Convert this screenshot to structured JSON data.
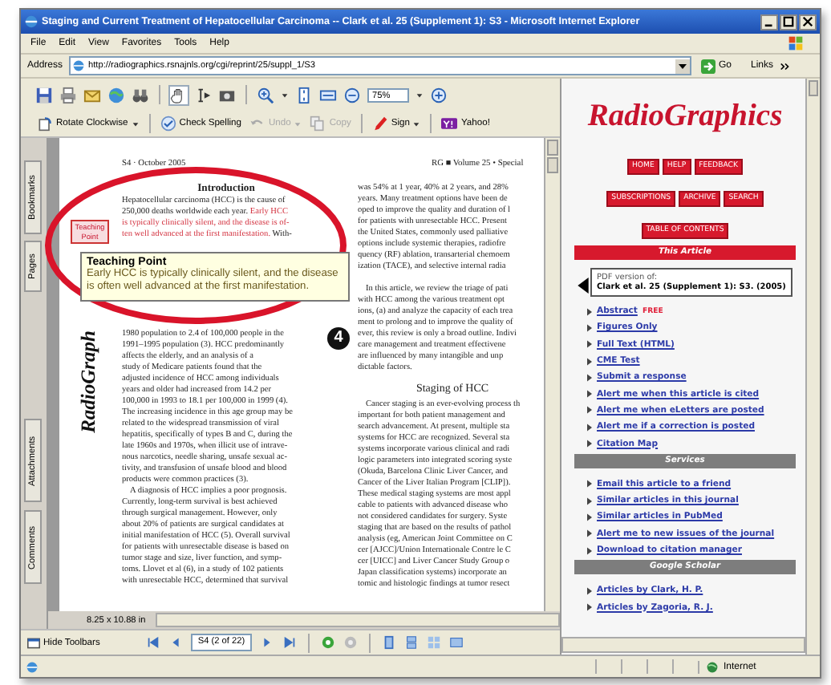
{
  "window": {
    "title": "Staging and Current Treatment of Hepatocellular Carcinoma -- Clark et al. 25 (Supplement 1): S3 - Microsoft Internet Explorer"
  },
  "menu": [
    "File",
    "Edit",
    "View",
    "Favorites",
    "Tools",
    "Help"
  ],
  "address_bar": {
    "label": "Address",
    "url": "http://radiographics.rsnajnls.org/cgi/reprint/25/suppl_1/S3",
    "go": "Go",
    "links": "Links"
  },
  "pdf_viewer": {
    "zoom": "75%",
    "buttons": [
      {
        "label": "Rotate Clockwise",
        "dropdown": true,
        "disabled": false
      },
      {
        "label": "Check Spelling",
        "dropdown": false,
        "disabled": false
      },
      {
        "label": "Undo",
        "dropdown": true,
        "disabled": true
      },
      {
        "label": "Copy",
        "dropdown": false,
        "disabled": true
      },
      {
        "label": "Sign",
        "dropdown": true,
        "disabled": false
      },
      {
        "label": "Yahoo!",
        "dropdown": false,
        "disabled": false
      }
    ],
    "side_tabs": [
      "Bookmarks",
      "Pages",
      "Attachments",
      "Comments"
    ],
    "page": {
      "header_left": "S4 · October 2005",
      "header_right": "RG ■ Volume 25 • Special",
      "spine": "RadioGraph",
      "left_column": {
        "heading": "Introduction",
        "lines_top": [
          {
            "segments": [
              {
                "text": "Hepatocellular carcinoma (HCC) is the cause of",
                "highlighted": false
              }
            ]
          },
          {
            "segments": [
              {
                "text": "250,000 deaths worldwide each year.",
                "highlighted": false
              },
              {
                "text": "Early HCC",
                "highlighted": true
              }
            ]
          },
          {
            "segments": [
              {
                "text": "is typically clinically silent, and the disease is of-",
                "highlighted": true
              }
            ]
          },
          {
            "segments": [
              {
                "text": "ten well advanced at the first manifestation.",
                "highlighted": true
              },
              {
                "text": "With-",
                "highlighted": false
              }
            ]
          }
        ],
        "paragraphs_bottom": [
          {
            "lines": [
              "1980 population to 2.4 of 100,000 people in the",
              "1991–1995 population (3). HCC predominantly",
              "affects the elderly, and an analysis of a",
              "study of Medicare patients found that the",
              "adjusted incidence of HCC among individuals",
              "years and older had increased from 14.2 per",
              "100,000 in 1993 to 18.1 per 100,000 in 1999 (4).",
              "The increasing incidence in this age group may be",
              "related to the widespread transmission of viral",
              "hepatitis, specifically of types B and C, during the",
              "late 1960s and 1970s, when illicit use of intrave-",
              "nous narcotics, needle sharing, unsafe sexual ac-",
              "tivity, and transfusion of unsafe blood and blood",
              "products were common practices (3)."
            ]
          },
          {
            "lines": [
              "A diagnosis of HCC implies a poor prognosis.",
              "Currently, long-term survival is best achieved",
              "through surgical management. However, only",
              "about 20% of patients are surgical candidates at",
              "initial manifestation of HCC (5). Overall survival",
              "for patients with unresectable disease is based on",
              "tumor stage and size, liver function, and symp-",
              "toms. Llovet et al (6), in a study of 102 patients",
              "with unresectable HCC, determined that survival"
            ]
          }
        ]
      },
      "right_column": {
        "blocks": [
          {
            "kind": "paragraph",
            "lines": [
              "was 54% at 1 year, 40% at 2 years, and 28%",
              "years. Many treatment options have been de",
              "oped to improve the quality and duration of l",
              "for patients with unresectable HCC. Present",
              "the United States, commonly used palliative",
              "options include systemic therapies, radiofre",
              "quency (RF) ablation, transarterial chemoem",
              "ization (TACE), and selective internal radia"
            ]
          },
          {
            "kind": "paragraph",
            "lines": [
              "In this article, we review the triage of pati",
              "with HCC among the various treatment opt",
              "ions, (a) and analyze the capacity of each trea",
              "ment to prolong and to improve the quality of",
              "ever, this review is only a broad outline. Indivi",
              "care management and treatment effectivene",
              "are influenced by many intangible and unp",
              "dictable factors."
            ]
          },
          {
            "kind": "heading",
            "text": "Staging of HCC"
          },
          {
            "kind": "paragraph",
            "lines": [
              "Cancer staging is an ever-evolving process th",
              "important for both patient management and",
              "search advancement. At present, multiple sta",
              "systems for HCC are recognized. Several sta",
              "systems incorporate various clinical and radi",
              "logic parameters into integrated scoring syste",
              "(Okuda, Barcelona Clinic Liver Cancer, and",
              "Cancer of the Liver Italian Program [CLIP]).",
              "These medical staging systems are most appl",
              "cable to patients with advanced disease who",
              "not considered candidates for surgery. Syste",
              "staging that are based on the results of pathol",
              "analysis (eg, American Joint Committee on C",
              "cer [AJCC]/Union Internationale Contre le C",
              "cer [UICC] and Liver Cancer Study Group o",
              "Japan classification systems) incorporate an",
              "tomic and histologic findings at tumor resect"
            ]
          }
        ]
      }
    },
    "teaching_point": {
      "button": "Teaching Point",
      "title": "Teaching Point",
      "text": "Early HCC is typically clinically silent, and the disease is often well advanced at the first manifestation."
    },
    "callout_number": "4",
    "page_size": "8.25 x 10.88 in",
    "hide_toolbars": "Hide Toolbars",
    "page_field": "S4 (2 of 22)"
  },
  "sidebar": {
    "logo": "RadioGraphics",
    "nav_rows": [
      [
        "HOME",
        "HELP",
        "FEEDBACK"
      ],
      [
        "SUBSCRIPTIONS",
        "ARCHIVE",
        "SEARCH"
      ],
      [
        "TABLE OF CONTENTS"
      ]
    ],
    "sections": [
      {
        "title": "This Article",
        "kind": "article",
        "pdf_box": {
          "label": "PDF version of:",
          "citation": "Clark et al. 25 (Supplement 1): S3. (2005)"
        },
        "links": [
          {
            "label": "Abstract",
            "badge": "FREE"
          },
          {
            "label": "Figures Only"
          },
          {
            "label": "Full Text (HTML)"
          },
          {
            "label": "CME Test"
          },
          {
            "label": "Submit a response"
          },
          {
            "label": "Alert me when this article is cited"
          },
          {
            "label": "Alert me when eLetters are posted"
          },
          {
            "label": "Alert me if a correction is posted"
          },
          {
            "label": "Citation Map"
          }
        ]
      },
      {
        "title": "Services",
        "kind": "plain",
        "links": [
          {
            "label": "Email this article to a friend"
          },
          {
            "label": "Similar articles in this journal"
          },
          {
            "label": "Similar articles in PubMed"
          },
          {
            "label": "Alert me to new issues of the journal"
          },
          {
            "label": "Download to citation manager"
          }
        ]
      },
      {
        "title": "Google Scholar",
        "kind": "plain",
        "links": [
          {
            "label": "Articles by Clark, H. P."
          },
          {
            "label": "Articles by Zagoria, R. J."
          }
        ]
      }
    ]
  },
  "status_bar": {
    "zone": "Internet"
  }
}
